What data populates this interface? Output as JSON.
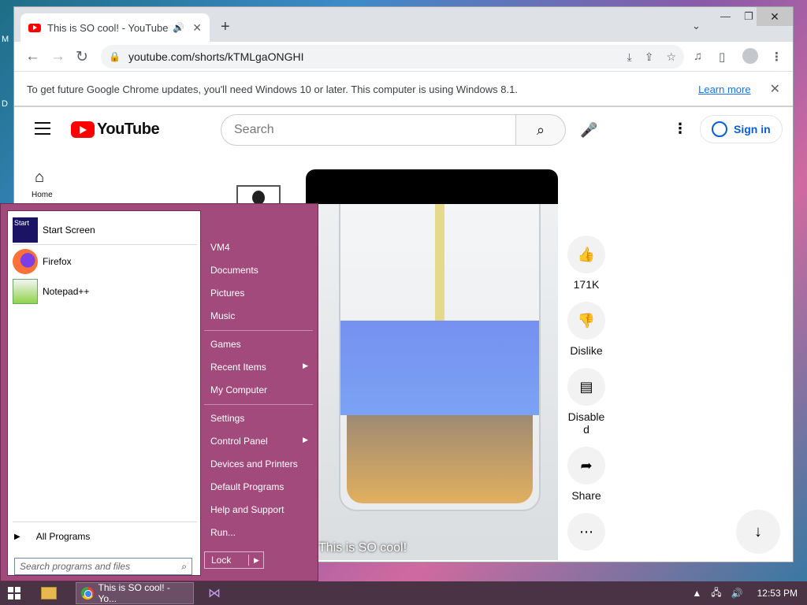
{
  "browser": {
    "tab_title": "This is SO cool! - YouTube",
    "new_tab": "+",
    "url": "youtube.com/shorts/kTMLgaONGHI",
    "infobar_message": "To get future Google Chrome updates, you'll need Windows 10 or later. This computer is using Windows 8.1.",
    "infobar_link": "Learn more"
  },
  "youtube": {
    "logo_text": "YouTube",
    "search_placeholder": "Search",
    "signin_label": "Sign in",
    "home_label": "Home",
    "short_title": "This is SO cool!",
    "actions": {
      "like_count": "171K",
      "dislike_label": "Dislike",
      "comments_label": "Disable\nd",
      "share_label": "Share"
    }
  },
  "start_menu": {
    "pinned": [
      {
        "label": "Start Screen",
        "icon": "start-screen-icon"
      },
      {
        "label": "Firefox",
        "icon": "firefox-icon"
      },
      {
        "label": "Notepad++",
        "icon": "notepadpp-icon"
      }
    ],
    "all_programs": "All Programs",
    "search_placeholder": "Search programs and files",
    "right_links": {
      "vm4": "VM4",
      "documents": "Documents",
      "pictures": "Pictures",
      "music": "Music",
      "games": "Games",
      "recent_items": "Recent Items",
      "my_computer": "My Computer",
      "settings": "Settings",
      "control_panel": "Control Panel",
      "devices": "Devices and Printers",
      "default_programs": "Default Programs",
      "help": "Help and Support",
      "run": "Run..."
    },
    "lock_label": "Lock"
  },
  "taskbar": {
    "chrome_label": "This is SO cool! - Yo...",
    "clock": "12:53 PM"
  },
  "colors": {
    "start_menu_accent": "#a24a7c",
    "youtube_red": "#ff0000",
    "link_blue": "#065fd4"
  }
}
